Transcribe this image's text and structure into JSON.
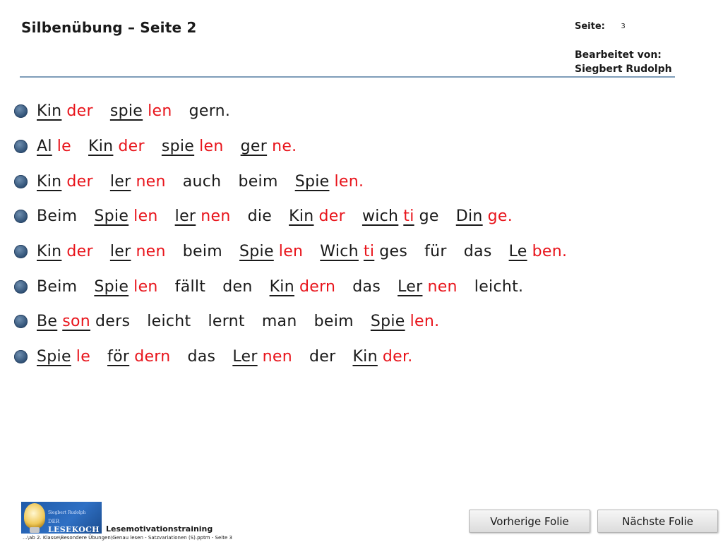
{
  "header": {
    "title": "Silbenübung – Seite 2",
    "page_label": "Seite:",
    "page_number": "3",
    "editor_label": "Bearbeitet von:",
    "editor_name": "Siegbert Rudolph"
  },
  "colors": {
    "accent_red": "#e8141b",
    "rule": "#7f9db9",
    "bullet": "#2d4e73"
  },
  "sentences": [
    {
      "words": [
        [
          {
            "t": "Kin",
            "c": "black",
            "u": true
          },
          {
            "t": "der",
            "c": "red",
            "u": false
          }
        ],
        [
          {
            "t": "spie",
            "c": "black",
            "u": true
          },
          {
            "t": "len",
            "c": "red",
            "u": false
          }
        ],
        [
          {
            "t": "gern.",
            "c": "black",
            "u": false
          }
        ]
      ]
    },
    {
      "words": [
        [
          {
            "t": "Al",
            "c": "black",
            "u": true
          },
          {
            "t": "le",
            "c": "red",
            "u": false
          }
        ],
        [
          {
            "t": "Kin",
            "c": "black",
            "u": true
          },
          {
            "t": "der",
            "c": "red",
            "u": false
          }
        ],
        [
          {
            "t": "spie",
            "c": "black",
            "u": true
          },
          {
            "t": "len",
            "c": "red",
            "u": false
          }
        ],
        [
          {
            "t": "ger",
            "c": "black",
            "u": true
          },
          {
            "t": "ne.",
            "c": "red",
            "u": false
          }
        ]
      ]
    },
    {
      "words": [
        [
          {
            "t": "Kin",
            "c": "black",
            "u": true
          },
          {
            "t": "der",
            "c": "red",
            "u": false
          }
        ],
        [
          {
            "t": "ler",
            "c": "black",
            "u": true
          },
          {
            "t": "nen",
            "c": "red",
            "u": false
          }
        ],
        [
          {
            "t": "auch",
            "c": "black",
            "u": false
          }
        ],
        [
          {
            "t": "beim",
            "c": "black",
            "u": false
          }
        ],
        [
          {
            "t": "Spie",
            "c": "black",
            "u": true
          },
          {
            "t": "len.",
            "c": "red",
            "u": false
          }
        ]
      ]
    },
    {
      "words": [
        [
          {
            "t": "Beim",
            "c": "black",
            "u": false
          }
        ],
        [
          {
            "t": "Spie",
            "c": "black",
            "u": true
          },
          {
            "t": "len",
            "c": "red",
            "u": false
          }
        ],
        [
          {
            "t": "ler",
            "c": "black",
            "u": true
          },
          {
            "t": "nen",
            "c": "red",
            "u": false
          }
        ],
        [
          {
            "t": "die",
            "c": "black",
            "u": false
          }
        ],
        [
          {
            "t": "Kin",
            "c": "black",
            "u": true
          },
          {
            "t": "der",
            "c": "red",
            "u": false
          }
        ],
        [
          {
            "t": "wich",
            "c": "black",
            "u": true
          },
          {
            "t": "ti",
            "c": "red",
            "u": true
          },
          {
            "t": "ge",
            "c": "black",
            "u": false
          }
        ],
        [
          {
            "t": "Din",
            "c": "black",
            "u": true
          },
          {
            "t": "ge.",
            "c": "red",
            "u": false
          }
        ]
      ]
    },
    {
      "words": [
        [
          {
            "t": "Kin",
            "c": "black",
            "u": true
          },
          {
            "t": "der",
            "c": "red",
            "u": false
          }
        ],
        [
          {
            "t": "ler",
            "c": "black",
            "u": true
          },
          {
            "t": "nen",
            "c": "red",
            "u": false
          }
        ],
        [
          {
            "t": "beim",
            "c": "black",
            "u": false
          }
        ],
        [
          {
            "t": "Spie",
            "c": "black",
            "u": true
          },
          {
            "t": "len",
            "c": "red",
            "u": false
          }
        ],
        [
          {
            "t": "Wich",
            "c": "black",
            "u": true
          },
          {
            "t": "ti",
            "c": "red",
            "u": true
          },
          {
            "t": "ges",
            "c": "black",
            "u": false
          }
        ],
        [
          {
            "t": "für",
            "c": "black",
            "u": false
          }
        ],
        [
          {
            "t": "das",
            "c": "black",
            "u": false
          }
        ],
        [
          {
            "t": "Le",
            "c": "black",
            "u": true
          },
          {
            "t": "ben.",
            "c": "red",
            "u": false
          }
        ]
      ]
    },
    {
      "words": [
        [
          {
            "t": "Beim",
            "c": "black",
            "u": false
          }
        ],
        [
          {
            "t": "Spie",
            "c": "black",
            "u": true
          },
          {
            "t": "len",
            "c": "red",
            "u": false
          }
        ],
        [
          {
            "t": "fällt",
            "c": "black",
            "u": false
          }
        ],
        [
          {
            "t": "den",
            "c": "black",
            "u": false
          }
        ],
        [
          {
            "t": "Kin",
            "c": "black",
            "u": true
          },
          {
            "t": "dern",
            "c": "red",
            "u": false
          }
        ],
        [
          {
            "t": "das",
            "c": "black",
            "u": false
          }
        ],
        [
          {
            "t": "Ler",
            "c": "black",
            "u": true
          },
          {
            "t": "nen",
            "c": "red",
            "u": false
          }
        ],
        [
          {
            "t": "leicht.",
            "c": "black",
            "u": false
          }
        ]
      ]
    },
    {
      "words": [
        [
          {
            "t": "Be",
            "c": "black",
            "u": true
          },
          {
            "t": "son",
            "c": "red",
            "u": true
          },
          {
            "t": "ders",
            "c": "black",
            "u": false
          }
        ],
        [
          {
            "t": "leicht",
            "c": "black",
            "u": false
          }
        ],
        [
          {
            "t": "lernt",
            "c": "black",
            "u": false
          }
        ],
        [
          {
            "t": "man",
            "c": "black",
            "u": false
          }
        ],
        [
          {
            "t": "beim",
            "c": "black",
            "u": false
          }
        ],
        [
          {
            "t": "Spie",
            "c": "black",
            "u": true
          },
          {
            "t": "len.",
            "c": "red",
            "u": false
          }
        ]
      ]
    },
    {
      "words": [
        [
          {
            "t": "Spie",
            "c": "black",
            "u": true
          },
          {
            "t": "le",
            "c": "red",
            "u": false
          }
        ],
        [
          {
            "t": "för",
            "c": "black",
            "u": true
          },
          {
            "t": "dern",
            "c": "red",
            "u": false
          }
        ],
        [
          {
            "t": "das",
            "c": "black",
            "u": false
          }
        ],
        [
          {
            "t": "Ler",
            "c": "black",
            "u": true
          },
          {
            "t": "nen",
            "c": "red",
            "u": false
          }
        ],
        [
          {
            "t": "der",
            "c": "black",
            "u": false
          }
        ],
        [
          {
            "t": "Kin",
            "c": "black",
            "u": true
          },
          {
            "t": "der.",
            "c": "red",
            "u": false
          }
        ]
      ]
    }
  ],
  "footer": {
    "logo_author": "Siegbert Rudolph",
    "logo_brand_small": "DER",
    "logo_brand": "LESEKOCH",
    "title": "Lesemotivationstraining",
    "path": "...\\ab 2. Klasse\\Besondere Übungen\\Genau lesen - Satzvariationen (S).pptm - Seite 3"
  },
  "nav": {
    "prev_label": "Vorherige Folie",
    "next_label": "Nächste Folie"
  }
}
